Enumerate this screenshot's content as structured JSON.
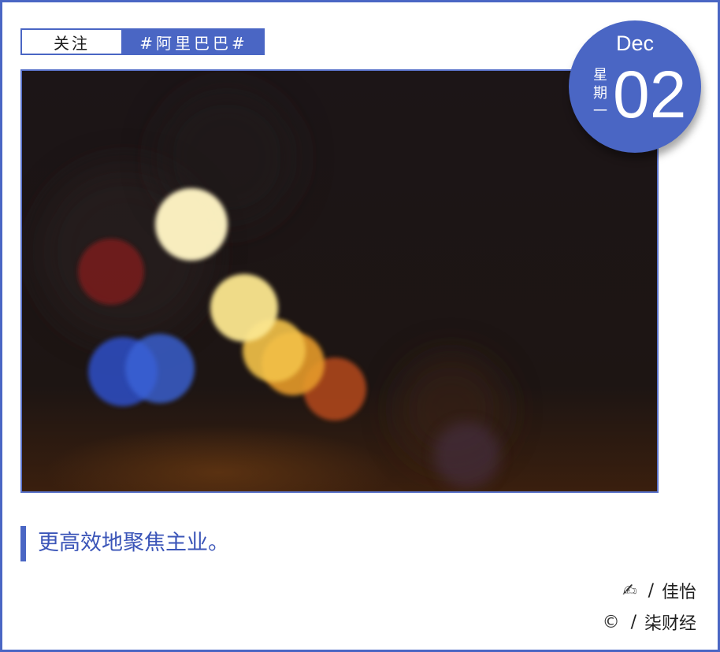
{
  "tags": {
    "follow_label": "关注",
    "topic_label": "#阿里巴巴#"
  },
  "date_badge": {
    "month": "Dec",
    "weekday": "星期一",
    "day": "02"
  },
  "headline": "更高效地聚焦主业。",
  "credits": {
    "author_icon": "pen-writing-icon",
    "author_separator": "/",
    "author": "佳怡",
    "source_icon": "copyright-icon",
    "source_separator": "/",
    "source": "柒财经"
  },
  "colors": {
    "accent": "#4a66c4",
    "headline_text": "#3b55b8",
    "photo_background": "#1b1416"
  }
}
